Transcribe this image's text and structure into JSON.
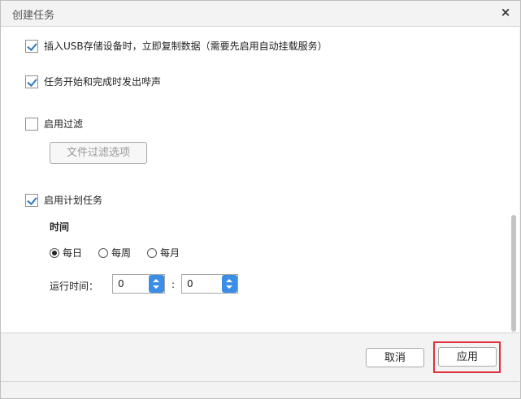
{
  "dialog": {
    "title": "创建任务",
    "close_symbol": "×"
  },
  "options": {
    "usb_copy": {
      "label": "插入USB存储设备时，立即复制数据（需要先启用自动挂载服务）",
      "checked": true
    },
    "beep": {
      "label": "任务开始和完成时发出哔声",
      "checked": true
    },
    "filter": {
      "label": "启用过滤",
      "checked": false
    },
    "filter_options_button": "文件过滤选项",
    "schedule": {
      "label": "启用计划任务",
      "checked": true
    }
  },
  "schedule": {
    "section_title": "时间",
    "frequency": [
      {
        "label": "每日",
        "selected": true
      },
      {
        "label": "每周",
        "selected": false
      },
      {
        "label": "每月",
        "selected": false
      }
    ],
    "run_time_label": "运行时间：",
    "hour": "0",
    "separator": ":",
    "minute": "0"
  },
  "footer": {
    "cancel_label": "取消",
    "apply_label": "应用"
  },
  "colors": {
    "accent": "#3a8ee6",
    "highlight": "#e0303a"
  }
}
